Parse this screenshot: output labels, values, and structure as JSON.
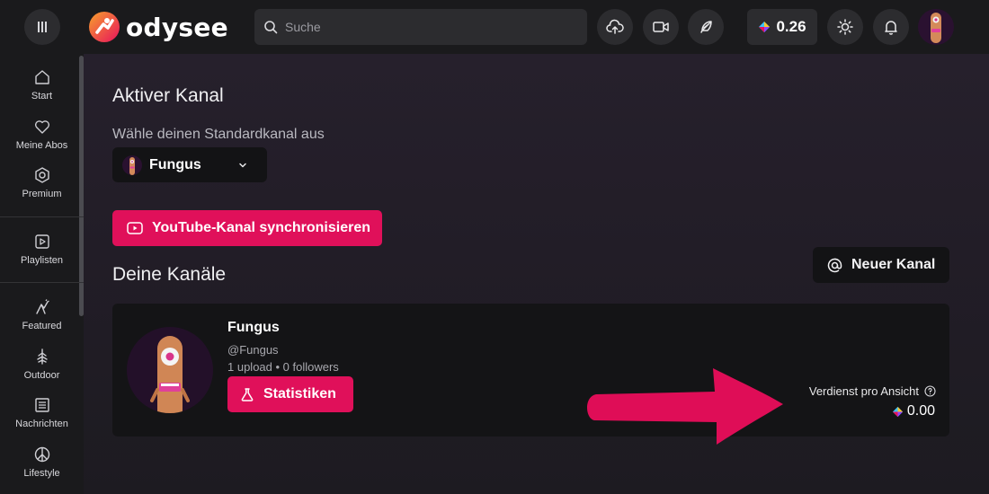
{
  "header": {
    "brand": "odysee",
    "search_placeholder": "Suche",
    "wallet_balance": "0.26",
    "icons": [
      "menu-icon",
      "upload-icon",
      "video-camera-icon",
      "feather-icon",
      "light-mode-icon",
      "bell-icon"
    ]
  },
  "sidebar": {
    "items": [
      {
        "label": "Start",
        "icon": "home-icon"
      },
      {
        "label": "Meine Abos",
        "icon": "heart-icon"
      },
      {
        "label": "Premium",
        "icon": "premium-badge-icon"
      },
      {
        "label": "Playlisten",
        "icon": "playlist-icon"
      },
      {
        "label": "Featured",
        "icon": "featured-icon"
      },
      {
        "label": "Outdoor",
        "icon": "tree-icon"
      },
      {
        "label": "Nachrichten",
        "icon": "newspaper-icon"
      },
      {
        "label": "Lifestyle",
        "icon": "peace-icon"
      }
    ]
  },
  "main": {
    "active_channel_title": "Aktiver Kanal",
    "default_channel_label": "Wähle deinen Standardkanal aus",
    "selected_channel": "Fungus",
    "youtube_sync_label": "YouTube-Kanal synchronisieren",
    "your_channels_title": "Deine Kanäle",
    "new_channel_label": "Neuer Kanal",
    "channel_card": {
      "name": "Fungus",
      "handle": "@Fungus",
      "stats": "1 upload • 0 followers",
      "stats_button": "Statistiken",
      "earnings_label": "Verdienst pro Ansicht",
      "earnings_value": "0.00"
    }
  },
  "colors": {
    "accent": "#e0105a",
    "background": "#1c1a20",
    "card": "#141416"
  }
}
